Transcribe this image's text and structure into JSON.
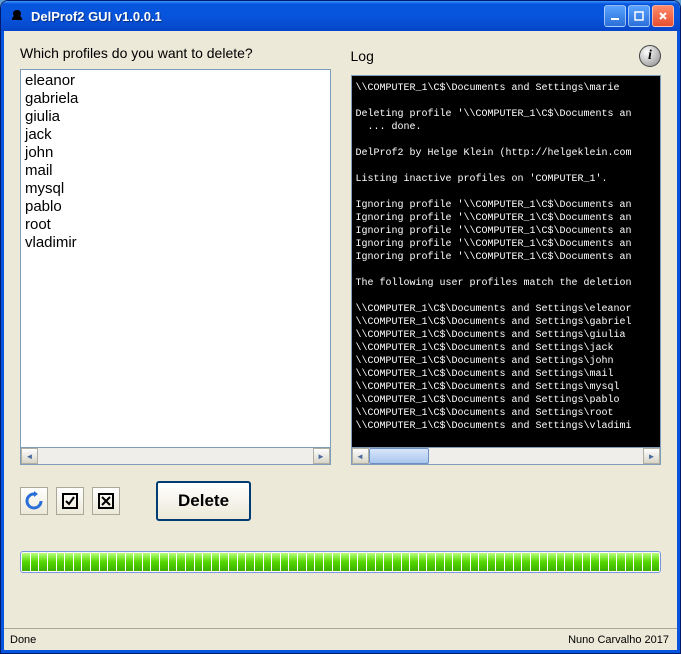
{
  "window": {
    "title": "DelProf2 GUI v1.0.0.1"
  },
  "labels": {
    "question": "Which profiles do you want to delete?",
    "log": "Log"
  },
  "profiles": [
    "eleanor",
    "gabriela",
    "giulia",
    "jack",
    "john",
    "mail",
    "mysql",
    "pablo",
    "root",
    "vladimir"
  ],
  "log_lines": [
    "\\\\COMPUTER_1\\C$\\Documents and Settings\\marie",
    "",
    "Deleting profile '\\\\COMPUTER_1\\C$\\Documents an",
    "  ... done.",
    "",
    "DelProf2 by Helge Klein (http://helgeklein.com",
    "",
    "Listing inactive profiles on 'COMPUTER_1'.",
    "",
    "Ignoring profile '\\\\COMPUTER_1\\C$\\Documents an",
    "Ignoring profile '\\\\COMPUTER_1\\C$\\Documents an",
    "Ignoring profile '\\\\COMPUTER_1\\C$\\Documents an",
    "Ignoring profile '\\\\COMPUTER_1\\C$\\Documents an",
    "Ignoring profile '\\\\COMPUTER_1\\C$\\Documents an",
    "",
    "The following user profiles match the deletion",
    "",
    "\\\\COMPUTER_1\\C$\\Documents and Settings\\eleanor",
    "\\\\COMPUTER_1\\C$\\Documents and Settings\\gabriel",
    "\\\\COMPUTER_1\\C$\\Documents and Settings\\giulia",
    "\\\\COMPUTER_1\\C$\\Documents and Settings\\jack",
    "\\\\COMPUTER_1\\C$\\Documents and Settings\\john",
    "\\\\COMPUTER_1\\C$\\Documents and Settings\\mail",
    "\\\\COMPUTER_1\\C$\\Documents and Settings\\mysql",
    "\\\\COMPUTER_1\\C$\\Documents and Settings\\pablo",
    "\\\\COMPUTER_1\\C$\\Documents and Settings\\root",
    "\\\\COMPUTER_1\\C$\\Documents and Settings\\vladimi"
  ],
  "buttons": {
    "delete": "Delete"
  },
  "icons": {
    "refresh": "refresh-icon",
    "select_all": "select-all-icon",
    "select_none": "select-none-icon",
    "info": "info-icon"
  },
  "progress": {
    "segments": 74,
    "complete": true
  },
  "status": {
    "left": "Done",
    "right": "Nuno Carvalho 2017"
  }
}
